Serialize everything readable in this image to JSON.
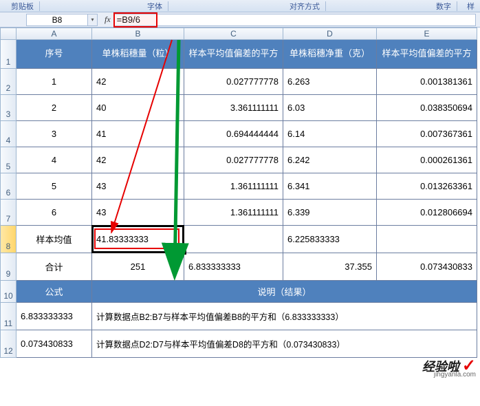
{
  "ribbon": {
    "clipboard": "剪贴板",
    "font": "字体",
    "alignment": "对齐方式",
    "number": "数字",
    "more": "样"
  },
  "namebox": "B8",
  "formula": "=B9/6",
  "fx_label": "fx",
  "col_headers": [
    "A",
    "B",
    "C",
    "D",
    "E"
  ],
  "row_headers": [
    "1",
    "2",
    "3",
    "4",
    "5",
    "6",
    "7",
    "8",
    "9",
    "10",
    "11",
    "12"
  ],
  "headers": {
    "A": "序号",
    "B": "单株稻穗量（粒）",
    "C": "样本平均值偏差的平方",
    "D": "单株稻穗净重（克）",
    "E": "样本平均值偏差的平方"
  },
  "rows": [
    {
      "A": "1",
      "B": "42",
      "C": "0.027777778",
      "D": "6.263",
      "E": "0.001381361"
    },
    {
      "A": "2",
      "B": "40",
      "C": "3.361111111",
      "D": "6.03",
      "E": "0.038350694"
    },
    {
      "A": "3",
      "B": "41",
      "C": "0.694444444",
      "D": "6.14",
      "E": "0.007367361"
    },
    {
      "A": "4",
      "B": "42",
      "C": "0.027777778",
      "D": "6.242",
      "E": "0.000261361"
    },
    {
      "A": "5",
      "B": "43",
      "C": "1.361111111",
      "D": "6.341",
      "E": "0.013263361"
    },
    {
      "A": "6",
      "B": "43",
      "C": "1.361111111",
      "D": "6.339",
      "E": "0.012806694"
    }
  ],
  "summary": {
    "mean_label": "样本均值",
    "mean_B": "41.83333333",
    "mean_D": "6.225833333",
    "sum_label": "合计",
    "sum_B": "251",
    "sum_C": "6.833333333",
    "sum_D": "37.355",
    "sum_E": "0.073430833"
  },
  "formula_section": {
    "formula_hdr": "公式",
    "explain_hdr": "说明（结果）",
    "r11_A": "6.833333333",
    "r11_rest": "计算数据点B2:B7与样本平均值偏差B8的平方和（6.833333333）",
    "r12_A": "0.073430833",
    "r12_rest": "计算数据点D2:D7与样本平均值偏差D8的平方和（0.073430833）"
  },
  "watermark": {
    "text": "经验啦",
    "url": "jingyanla.com"
  }
}
